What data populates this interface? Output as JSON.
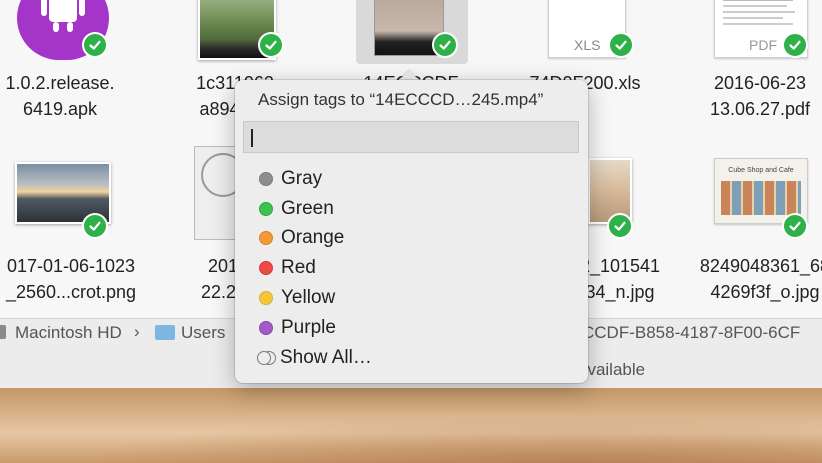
{
  "files": [
    {
      "name_line1": "1.0.2.release.",
      "name_line2": "6419.apk",
      "icon": "android-app-icon",
      "tag": "green"
    },
    {
      "name_line1": "1c311062",
      "name_line2": "a894-4...",
      "icon": "image-thumbnail",
      "tag": "green"
    },
    {
      "name_line1": "14ECCCDF",
      "name_line2": "",
      "icon": "video-thumbnail",
      "tag": "green"
    },
    {
      "name_line1": "74D0F200.xls",
      "name_line2": "",
      "icon": "xls-document-icon",
      "thumb_label": "XLS",
      "tag": "green"
    },
    {
      "name_line1": "2016-06-23",
      "name_line2": "13.06.27.pdf",
      "icon": "pdf-document-icon",
      "thumb_label": "PDF",
      "tag": "green"
    },
    {
      "name_line1": "017-01-06-1023",
      "name_line2": "_2560...crot.png",
      "icon": "image-thumbnail",
      "tag": "green"
    },
    {
      "name_line1": "2018-",
      "name_line2": "22.21.5",
      "icon": "document-thumbnail",
      "tag": "green"
    },
    {
      "name_line1": "_2_101541",
      "name_line2": "_34_n.jpg",
      "icon": "photo-thumbnail",
      "tag": "green"
    },
    {
      "name_line1": "8249048361_68",
      "name_line2": "4269f3f_o.jpg",
      "icon": "photo-thumbnail",
      "thumb_label": "Cube Shop and Cafe",
      "tag": "green"
    }
  ],
  "pathbar": {
    "disk": "Macintosh HD",
    "separator": "›",
    "users": "Users",
    "tail": "CCDF-B858-4187-8F00-6CF"
  },
  "statusbar": {
    "text": "available"
  },
  "popover": {
    "title": "Assign tags to “14ECCCD…245.mp4”",
    "input_value": "",
    "tags": [
      {
        "label": "Gray",
        "color": "#8e8e8e"
      },
      {
        "label": "Green",
        "color": "#3cc24f"
      },
      {
        "label": "Orange",
        "color": "#f19a37"
      },
      {
        "label": "Red",
        "color": "#ee4a45"
      },
      {
        "label": "Yellow",
        "color": "#f5c63a"
      },
      {
        "label": "Purple",
        "color": "#a35bc9"
      }
    ],
    "show_all": "Show All…"
  },
  "colors": {
    "tag_badge": "#2fb14a",
    "android": "#a535c9",
    "selection": "#d9d9d9"
  }
}
